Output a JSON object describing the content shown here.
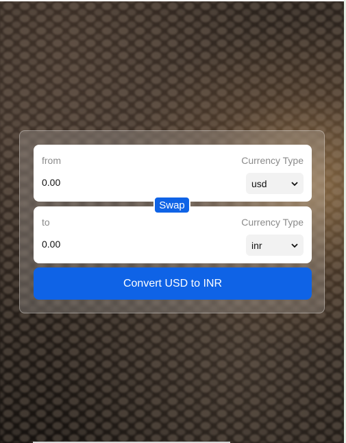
{
  "converter": {
    "from": {
      "label": "from",
      "currency_type_label": "Currency Type",
      "amount": "0.00",
      "currency": "usd"
    },
    "to": {
      "label": "to",
      "currency_type_label": "Currency Type",
      "amount": "0.00",
      "currency": "inr"
    },
    "swap_label": "Swap",
    "convert_label": "Convert USD to INR"
  },
  "colors": {
    "accent": "#0f63e6",
    "input_bg": "#ffffff",
    "select_bg": "#f2f2f2",
    "label": "#8a8a8a"
  },
  "icons": {
    "select_arrow": "chevron-down-icon"
  }
}
